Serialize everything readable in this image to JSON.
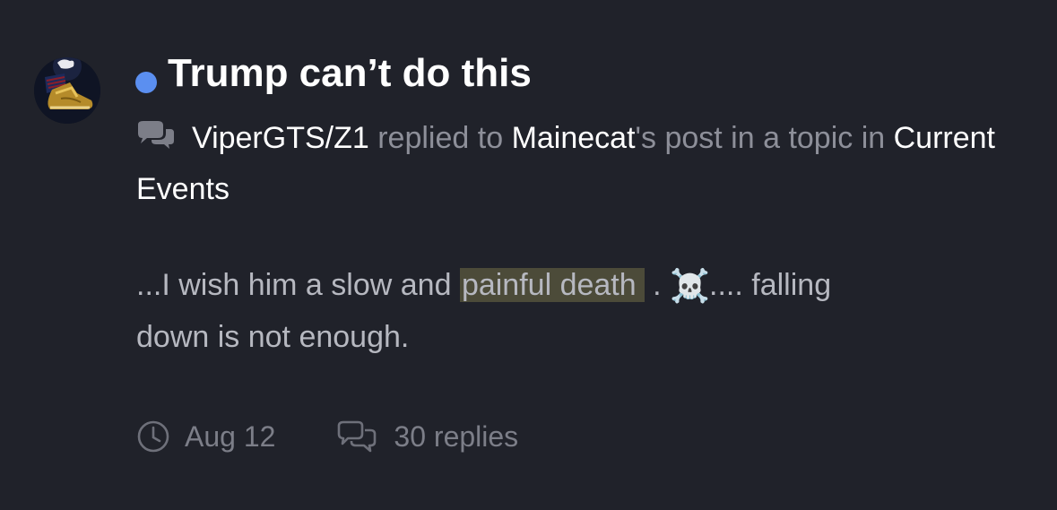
{
  "topic": {
    "title": "Trump can’t do this",
    "unread": true,
    "accent_color": "#5b8ff0"
  },
  "activity": {
    "icon": "chat-bubbles-icon",
    "actor": "ViperGTS/Z1",
    "action_text": "replied to",
    "recipient": "Mainecat",
    "suffix_text": "'s post in a topic in",
    "forum": "Current Events"
  },
  "excerpt": {
    "before": "...I wish him a slow and",
    "highlight": "painful death",
    "period": ".",
    "emoji": "☠️",
    "after_line1": ".... falling",
    "after_line2": "down is not enough."
  },
  "meta": {
    "date_icon": "clock-icon",
    "date": "Aug 12",
    "replies_icon": "replies-icon",
    "replies": "30 replies"
  },
  "avatar": {
    "icon": "sneaker-avatar-icon"
  }
}
